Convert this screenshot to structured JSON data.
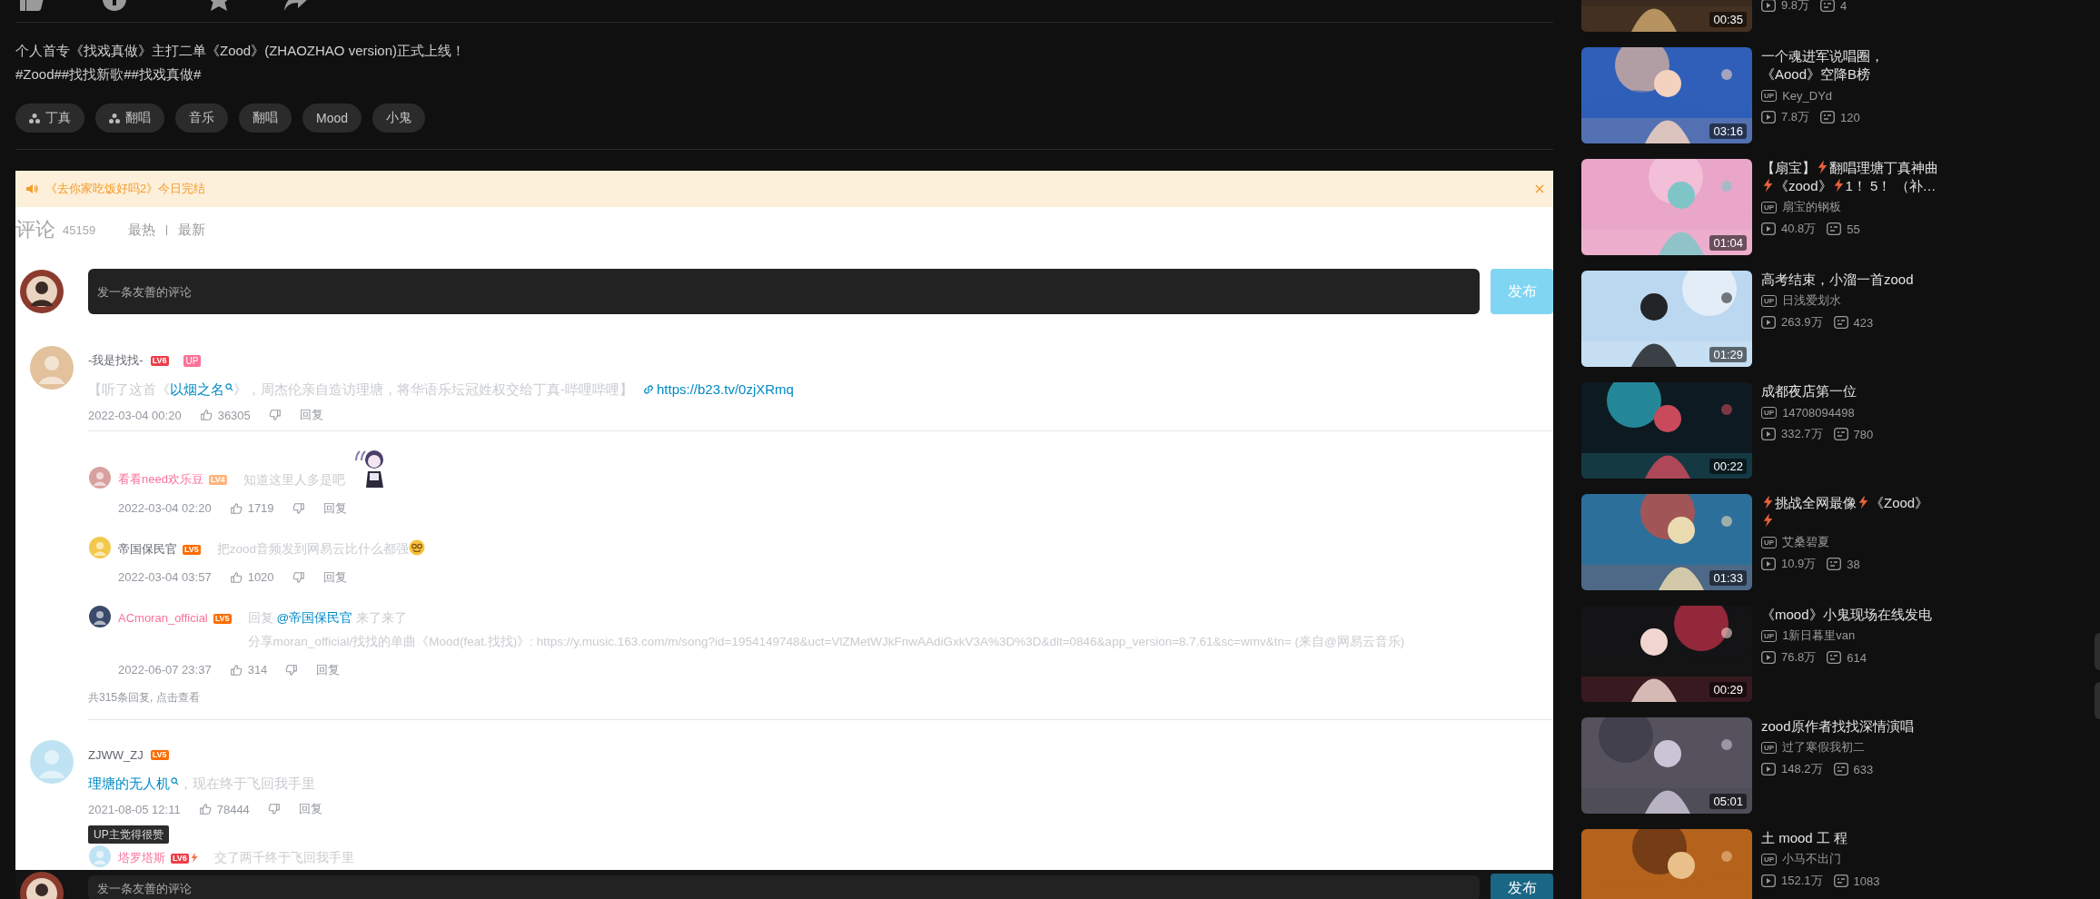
{
  "description": {
    "lines": [
      "个人首专《找戏真做》主打二单《Zood》(ZHAOZHAO version)正式上线！",
      "#Zood##找找新歌##找戏真做#"
    ]
  },
  "tags": [
    {
      "label": "丁真",
      "kind": "topic"
    },
    {
      "label": "翻唱",
      "kind": "topic"
    },
    {
      "label": "音乐",
      "kind": "plain"
    },
    {
      "label": "翻唱",
      "kind": "plain"
    },
    {
      "label": "Mood",
      "kind": "plain"
    },
    {
      "label": "小鬼",
      "kind": "plain"
    }
  ],
  "notice": {
    "text": "《去你家吃饭好吗2》今日完结"
  },
  "comments_header": {
    "title": "评论",
    "count": "45159",
    "sorts": [
      "最热",
      "最新"
    ]
  },
  "composer": {
    "placeholder": "发一条友善的评论",
    "button": "发布"
  },
  "comments": [
    {
      "user": {
        "name": "-我是找找-",
        "vip": false
      },
      "badge": {
        "text": "LV6",
        "color": "#ee3e4b"
      },
      "up_badge": "UP",
      "content": [
        {
          "kind": "text",
          "text": "【听了这首《"
        },
        {
          "kind": "keyword",
          "text": "以烟之名"
        },
        {
          "kind": "text",
          "text": "》，周杰伦亲自造访理塘，将华语乐坛冠姓权交给丁真-哔哩哔哩】"
        },
        {
          "kind": "url",
          "text": "https://b23.tv/0zjXRmq"
        }
      ],
      "time": "2022-03-04 00:20",
      "likes": "36305",
      "reply_label": "回复",
      "replies": [
        {
          "user": {
            "name": "看看need欢乐豆",
            "vip": true
          },
          "badge": {
            "text": "LV4",
            "color": "#ffb37c"
          },
          "content": [
            {
              "kind": "text",
              "text": "知道这里人多是吧"
            },
            {
              "kind": "sticker"
            }
          ],
          "time": "2022-03-04 02:20",
          "likes": "1719",
          "reply_label": "回复"
        },
        {
          "user": {
            "name": "帝国保民官",
            "vip": false
          },
          "badge": {
            "text": "LV5",
            "color": "#ff6c00"
          },
          "content": [
            {
              "kind": "text",
              "text": "把zood音频发到网易云比什么都强"
            },
            {
              "kind": "emoji"
            }
          ],
          "time": "2022-03-04 03:57",
          "likes": "1020",
          "reply_label": "回复"
        },
        {
          "user": {
            "name": "ACmoran_official",
            "vip": true
          },
          "badge": {
            "text": "LV5",
            "color": "#ff6c00"
          },
          "content": [
            {
              "kind": "text",
              "text": "回复 "
            },
            {
              "kind": "mention",
              "text": "@帝国保民官"
            },
            {
              "kind": "text",
              "text": " 来了来了"
            },
            {
              "kind": "break"
            },
            {
              "kind": "text",
              "text": "分享moran_official/找找的单曲《Mood(feat.找找)》: https://y.music.163.com/m/song?id=1954149748&uct=VlZMetWJkFnwAAdiGxkV3A%3D%3D&dlt=0846&app_version=8.7.61&sc=wmv&tn= (来自@网易云音乐)"
            }
          ],
          "time": "2022-06-07 23:37",
          "likes": "314",
          "reply_label": "回复"
        }
      ],
      "more": "共315条回复, 点击查看"
    },
    {
      "user": {
        "name": "ZJWW_ZJ",
        "vip": false
      },
      "badge": {
        "text": "LV5",
        "color": "#ff6c00"
      },
      "content": [
        {
          "kind": "keyword",
          "text": "理塘的无人机"
        },
        {
          "kind": "text",
          "text": "，现在终于飞回我手里"
        }
      ],
      "time": "2021-08-05 12:11",
      "likes": "78444",
      "reply_label": "回复",
      "up_liked": "UP主觉得很赞",
      "replies": [
        {
          "user": {
            "name": "塔罗塔斯",
            "vip": true
          },
          "badge": {
            "text": "LV6",
            "color": "#ee3e4b",
            "hardcore": true
          },
          "content": [
            {
              "kind": "text",
              "text": "交了两千终于飞回我手里"
            }
          ]
        }
      ]
    }
  ],
  "bottom_composer": {
    "placeholder": "发一条友善的评论",
    "button": "发布"
  },
  "sidebar": {
    "videos": [
      {
        "duration": "00:35",
        "plays": "9.8万",
        "danmaku": "4"
      },
      {
        "title": [
          {
            "kind": "text",
            "text": "一个魂进军说唱圈，《Aood》空降B榜"
          }
        ],
        "uploader": {
          "badge": "UP",
          "name": "Key_DYd"
        },
        "duration": "03:16",
        "plays": "7.8万",
        "danmaku": "120"
      },
      {
        "title": [
          {
            "kind": "text",
            "text": "【扇宝】"
          },
          {
            "kind": "bolt"
          },
          {
            "kind": "text",
            "text": "翻唱理塘丁真神曲"
          },
          {
            "kind": "bolt"
          },
          {
            "kind": "text",
            "text": "《zood》"
          },
          {
            "kind": "bolt"
          },
          {
            "kind": "text",
            "text": "1！ 5！ （补…"
          }
        ],
        "uploader": {
          "badge": "UP",
          "name": "扇宝的钢板"
        },
        "duration": "01:04",
        "plays": "40.8万",
        "danmaku": "55"
      },
      {
        "title": [
          {
            "kind": "text",
            "text": "高考结束，小溜一首zood"
          }
        ],
        "uploader": {
          "badge": "UP",
          "name": "日浅爱划水"
        },
        "duration": "01:29",
        "plays": "263.9万",
        "danmaku": "423"
      },
      {
        "title": [
          {
            "kind": "text",
            "text": "成都夜店第一位"
          }
        ],
        "uploader": {
          "badge": "UP",
          "name": "14708094498"
        },
        "duration": "00:22",
        "plays": "332.7万",
        "danmaku": "780"
      },
      {
        "title": [
          {
            "kind": "bolt"
          },
          {
            "kind": "text",
            "text": "挑战全网最像"
          },
          {
            "kind": "bolt"
          },
          {
            "kind": "text",
            "text": "《Zood》"
          },
          {
            "kind": "break"
          },
          {
            "kind": "bolt"
          }
        ],
        "uploader": {
          "badge": "UP",
          "name": "艾桑碧夏"
        },
        "duration": "01:33",
        "plays": "10.9万",
        "danmaku": "38"
      },
      {
        "title": [
          {
            "kind": "text",
            "text": "《mood》小鬼现场在线发电"
          }
        ],
        "uploader": {
          "badge": "UP",
          "name": "1新日暮里van"
        },
        "duration": "00:29",
        "plays": "76.8万",
        "danmaku": "614"
      },
      {
        "title": [
          {
            "kind": "text",
            "text": "zood原作者找找深情演唱"
          }
        ],
        "uploader": {
          "badge": "UP",
          "name": "过了寒假我初二"
        },
        "duration": "05:01",
        "plays": "148.2万",
        "danmaku": "633"
      },
      {
        "title": [
          {
            "kind": "text",
            "text": "土 mood 工 程"
          }
        ],
        "uploader": {
          "badge": "UP",
          "name": "小马不出门"
        },
        "plays": "152.1万",
        "danmaku": "1083"
      }
    ]
  }
}
